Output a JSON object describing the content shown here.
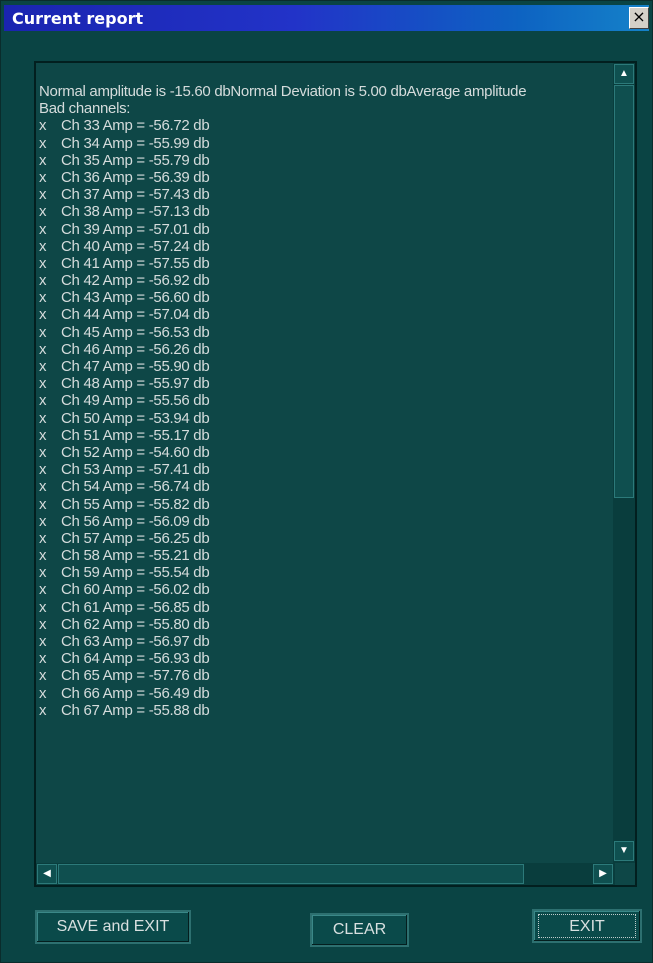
{
  "window": {
    "title": "Current report",
    "close_label": "×"
  },
  "report": {
    "summary": "Normal amplitude is -15.60 dbNormal Deviation is  5.00 dbAverage amplitude",
    "section_heading": "Bad channels:",
    "channels": [
      {
        "mark": "x",
        "text": "Ch 33 Amp = -56.72 db"
      },
      {
        "mark": "x",
        "text": "Ch 34 Amp = -55.99 db"
      },
      {
        "mark": "x",
        "text": "Ch 35 Amp = -55.79 db"
      },
      {
        "mark": "x",
        "text": "Ch 36 Amp = -56.39 db"
      },
      {
        "mark": "x",
        "text": "Ch 37 Amp = -57.43 db"
      },
      {
        "mark": "x",
        "text": "Ch 38 Amp = -57.13 db"
      },
      {
        "mark": "x",
        "text": "Ch 39 Amp = -57.01 db"
      },
      {
        "mark": "x",
        "text": "Ch 40 Amp = -57.24 db"
      },
      {
        "mark": "x",
        "text": "Ch 41 Amp = -57.55 db"
      },
      {
        "mark": "x",
        "text": "Ch 42 Amp = -56.92 db"
      },
      {
        "mark": "x",
        "text": "Ch 43 Amp = -56.60 db"
      },
      {
        "mark": "x",
        "text": "Ch 44 Amp = -57.04 db"
      },
      {
        "mark": "x",
        "text": "Ch 45 Amp = -56.53 db"
      },
      {
        "mark": "x",
        "text": "Ch 46 Amp = -56.26 db"
      },
      {
        "mark": "x",
        "text": "Ch 47 Amp = -55.90 db"
      },
      {
        "mark": "x",
        "text": "Ch 48 Amp = -55.97 db"
      },
      {
        "mark": "x",
        "text": "Ch 49 Amp = -55.56 db"
      },
      {
        "mark": "x",
        "text": "Ch 50 Amp = -53.94 db"
      },
      {
        "mark": "x",
        "text": "Ch 51 Amp = -55.17 db"
      },
      {
        "mark": "x",
        "text": "Ch 52 Amp = -54.60 db"
      },
      {
        "mark": "x",
        "text": "Ch 53 Amp = -57.41 db"
      },
      {
        "mark": "x",
        "text": "Ch 54 Amp = -56.74 db"
      },
      {
        "mark": "x",
        "text": "Ch 55 Amp = -55.82 db"
      },
      {
        "mark": "x",
        "text": "Ch 56 Amp = -56.09 db"
      },
      {
        "mark": "x",
        "text": "Ch 57 Amp = -56.25 db"
      },
      {
        "mark": "x",
        "text": "Ch 58 Amp = -55.21 db"
      },
      {
        "mark": "x",
        "text": "Ch 59 Amp = -55.54 db"
      },
      {
        "mark": "x",
        "text": "Ch 60 Amp = -56.02 db"
      },
      {
        "mark": "x",
        "text": "Ch 61 Amp = -56.85 db"
      },
      {
        "mark": "x",
        "text": "Ch 62 Amp = -55.80 db"
      },
      {
        "mark": "x",
        "text": "Ch 63 Amp = -56.97 db"
      },
      {
        "mark": "x",
        "text": "Ch 64 Amp = -56.93 db"
      },
      {
        "mark": "x",
        "text": "Ch 65 Amp = -57.76 db"
      },
      {
        "mark": "x",
        "text": "Ch 66 Amp = -56.49 db"
      },
      {
        "mark": "x",
        "text": "Ch 67 Amp = -55.88 db"
      }
    ]
  },
  "scrollbars": {
    "up_icon": "▲",
    "down_icon": "▼",
    "left_icon": "◀",
    "right_icon": "▶"
  },
  "buttons": {
    "save_label": "SAVE and EXIT",
    "clear_label": "CLEAR",
    "exit_label": "EXIT"
  },
  "colors": {
    "background": "#0a4444",
    "titlebar_start": "#1a24b0",
    "titlebar_end": "#1582c9",
    "text": "#d5dcdc"
  }
}
